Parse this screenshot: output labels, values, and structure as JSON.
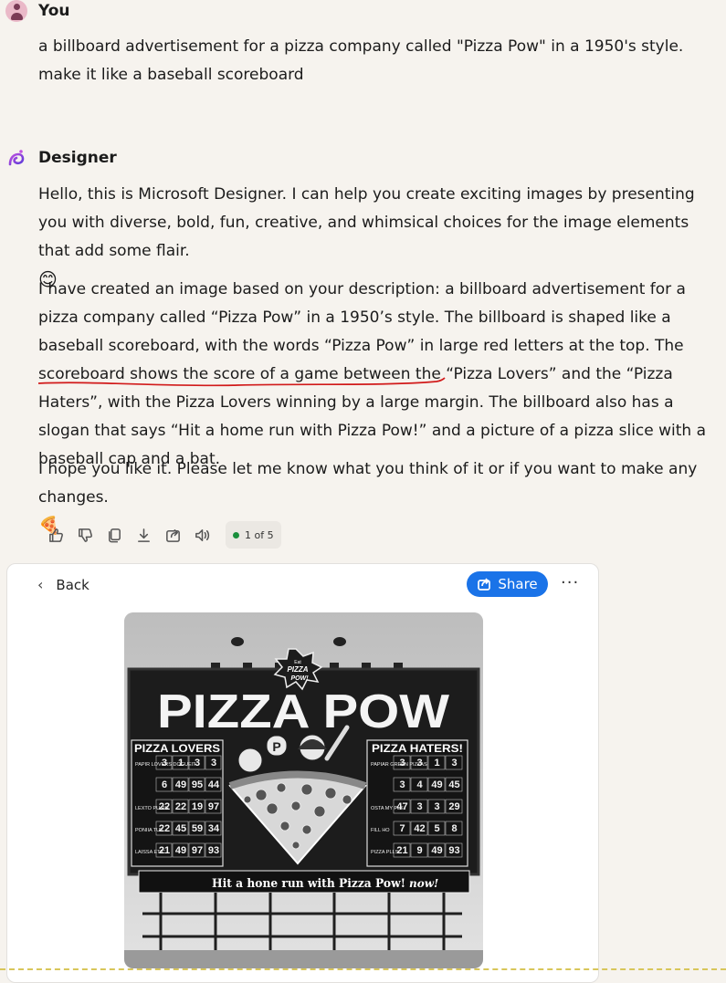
{
  "user": {
    "name": "You",
    "prompt": "a billboard advertisement for a pizza company called \"Pizza Pow\" in a 1950's style. make it like a baseball scoreboard"
  },
  "designer": {
    "name": "Designer",
    "intro": "Hello, this is Microsoft Designer. I can help you create exciting images by presenting you with diverse, bold, fun, creative, and whimsical choices for the image elements that add some flair.",
    "intro_emoji": "😊",
    "description_before": "I have created an image based on your description: a billboard advertisement for a pizza company called “Pizza Pow” in a 1950’s style. The billboard is shaped like a baseball scoreboard, with the words “Pizza Pow” in large red letters at the top. The scoreboard shows the score of a ",
    "description_underlined": "game between the “Pizza Lovers” and the “Pizza Haters”,",
    "description_after": " with the Pizza Lovers winning by a large margin. The billboard also has a slogan that says “Hit a home run with Pizza Pow!” and a picture of a pizza slice with a baseball cap and a bat.",
    "closing": "I hope you like it. Please let me know what you think of it or if you want to make any changes.",
    "closing_emoji": "🍕"
  },
  "actions": {
    "icons": [
      "thumbs-up-icon",
      "thumbs-down-icon",
      "copy-icon",
      "download-icon",
      "export-icon",
      "speaker-icon"
    ],
    "pager": "1 of 5"
  },
  "card": {
    "back_label": "Back",
    "share_label": "Share",
    "more_label": "···"
  },
  "billboard": {
    "star_text_small": "Eat",
    "star_text": "PIZZA",
    "star_text2": "POW!",
    "headline": "PIZZA POW",
    "left_team": "PIZZA LOVERS",
    "right_team": "PIZZA HATERS!",
    "left_rows": [
      {
        "label": "PAPIR LOVERS DOGUEIT",
        "nums": [
          "3",
          "1",
          "3",
          "3"
        ]
      },
      {
        "label": "",
        "nums": [
          "6",
          "49",
          "95",
          "44"
        ]
      },
      {
        "label": "LEXTO PU RH.",
        "nums": [
          "22",
          "22",
          "19",
          "97"
        ]
      },
      {
        "label": "PONIIA TUY",
        "nums": [
          "22",
          "45",
          "59",
          "34"
        ]
      },
      {
        "label": "LAISSA ETIC",
        "nums": [
          "21",
          "49",
          "97",
          "93"
        ]
      }
    ],
    "right_rows": [
      {
        "label": "PAPIAR GREEN PIZZAS",
        "nums": [
          "3",
          "3",
          "1",
          "3"
        ]
      },
      {
        "label": "",
        "nums": [
          "3",
          "4",
          "49",
          "45"
        ]
      },
      {
        "label": "OSTA MY PLE",
        "nums": [
          "47",
          "3",
          "3",
          "29"
        ]
      },
      {
        "label": "FILL HO",
        "nums": [
          "7",
          "42",
          "5",
          "8"
        ]
      },
      {
        "label": "PIZZA PLLS",
        "nums": [
          "21",
          "9",
          "49",
          "93"
        ]
      }
    ],
    "slogan": "Hit a hone run with Pizza Pow!",
    "slogan_tail": "now!"
  },
  "colors": {
    "share_blue": "#1a73e8",
    "underline_red": "#d11a1a",
    "pager_dot": "#1a8f3c"
  }
}
